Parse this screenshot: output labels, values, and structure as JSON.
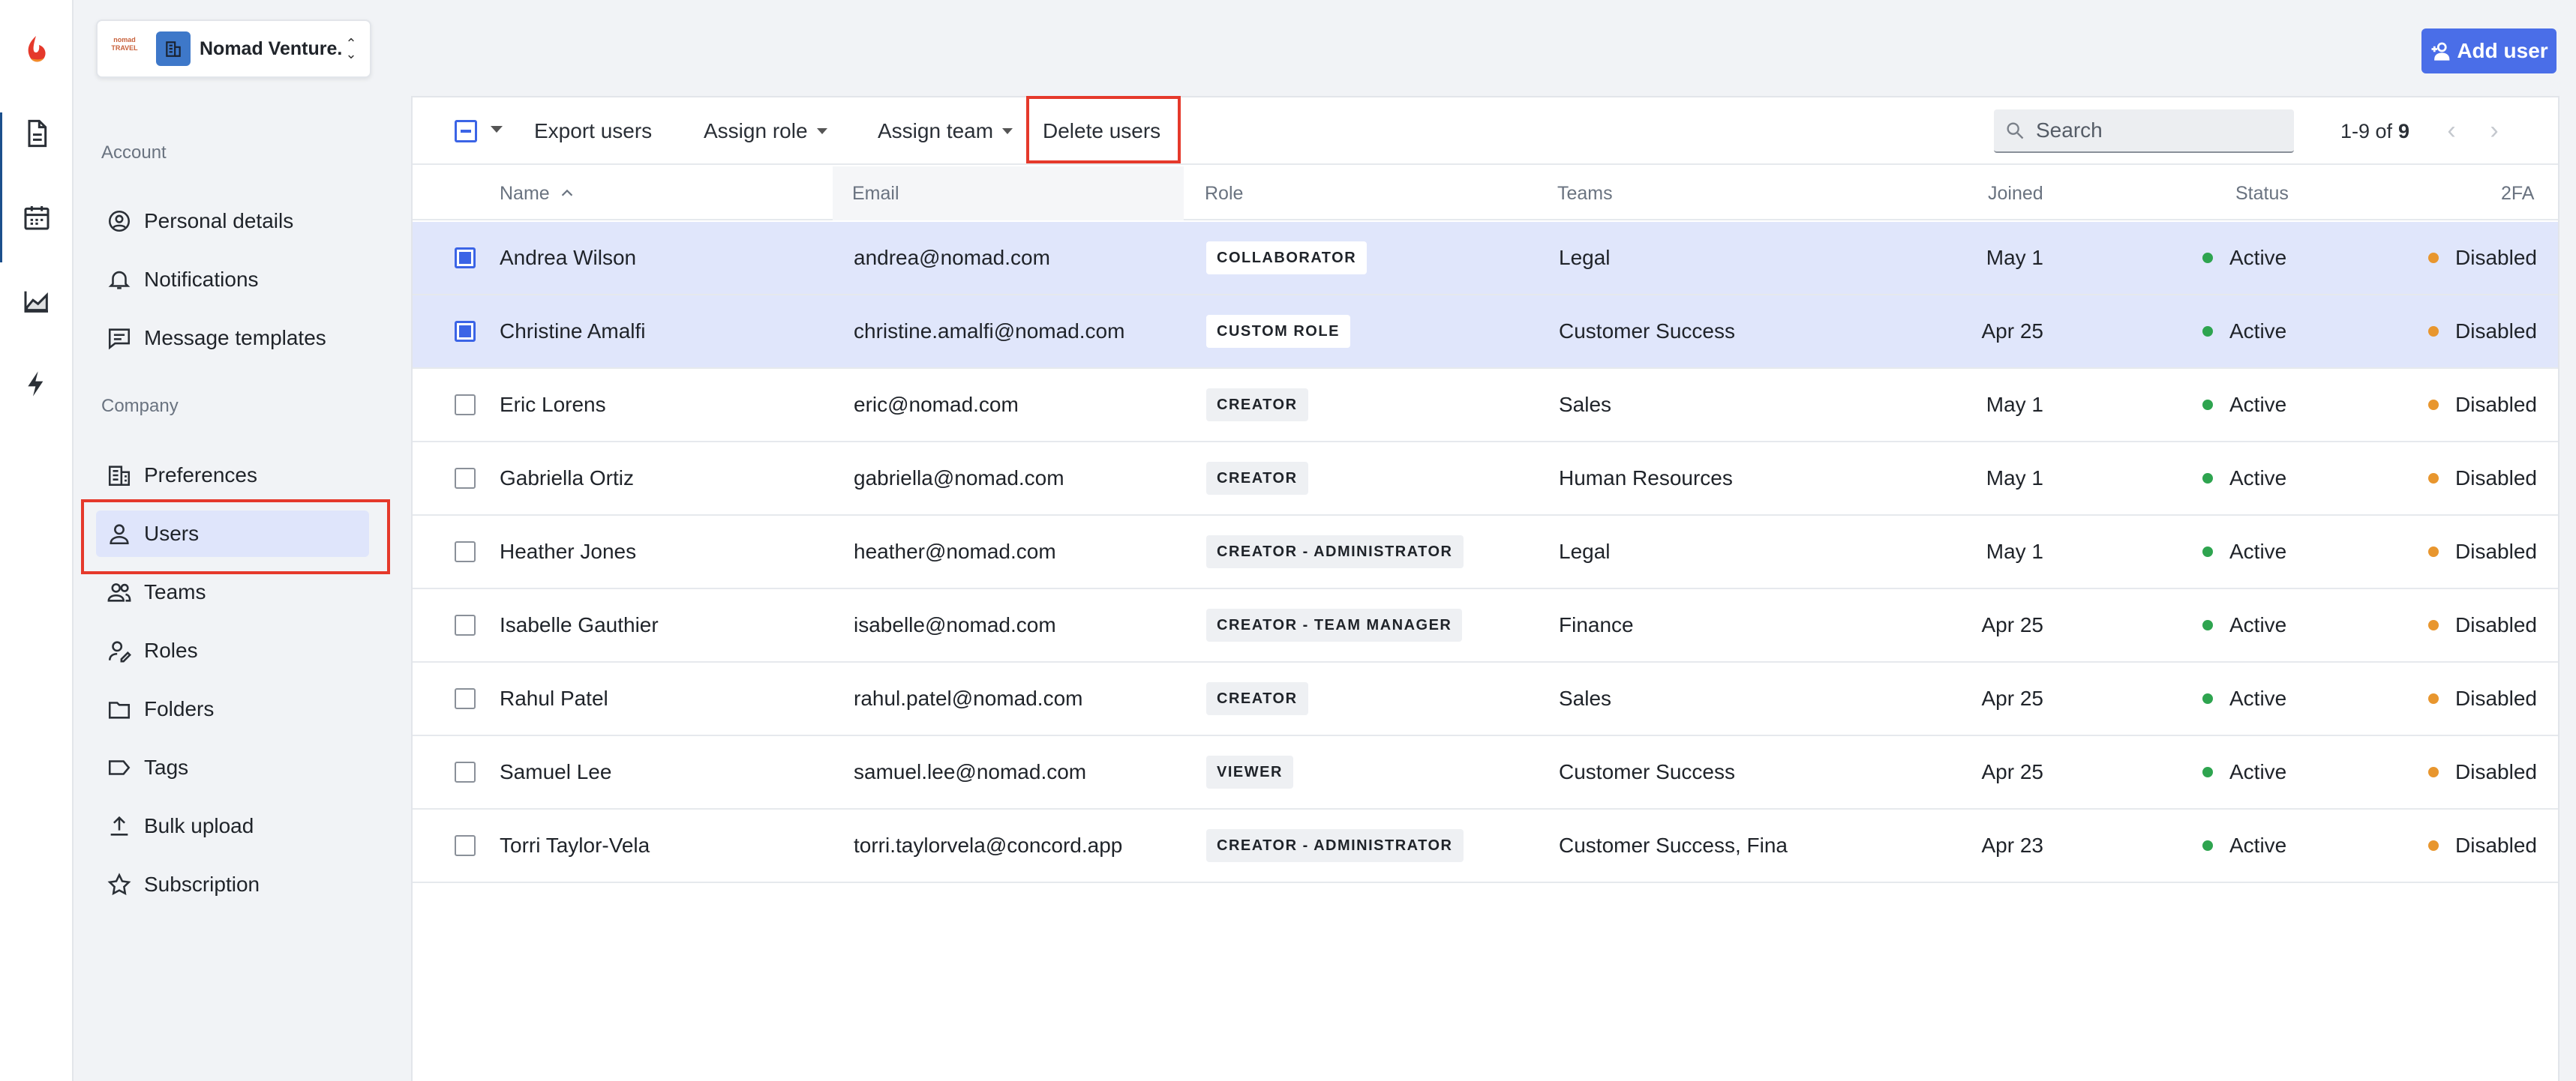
{
  "org": {
    "logo_text": "nomad TRAVEL",
    "name": "Nomad Venture..."
  },
  "sidebar": {
    "account_label": "Account",
    "company_label": "Company",
    "account_items": [
      {
        "label": "Personal details",
        "icon": "person-circle-icon"
      },
      {
        "label": "Notifications",
        "icon": "bell-icon"
      },
      {
        "label": "Message templates",
        "icon": "message-icon"
      }
    ],
    "company_items": [
      {
        "label": "Preferences",
        "icon": "building-settings-icon"
      },
      {
        "label": "Users",
        "icon": "person-icon",
        "active": true
      },
      {
        "label": "Teams",
        "icon": "people-icon"
      },
      {
        "label": "Roles",
        "icon": "person-edit-icon"
      },
      {
        "label": "Folders",
        "icon": "folder-icon"
      },
      {
        "label": "Tags",
        "icon": "tag-icon"
      },
      {
        "label": "Bulk upload",
        "icon": "upload-icon"
      },
      {
        "label": "Subscription",
        "icon": "star-icon"
      }
    ]
  },
  "header": {
    "add_user_label": "Add user"
  },
  "toolbar": {
    "export_label": "Export users",
    "assign_role_label": "Assign role",
    "assign_team_label": "Assign team",
    "delete_label": "Delete users",
    "search_placeholder": "Search",
    "pager_range": "1-9 of",
    "pager_total": "9"
  },
  "table": {
    "columns": [
      "Name",
      "Email",
      "Role",
      "Teams",
      "Joined",
      "Status",
      "2FA"
    ],
    "rows": [
      {
        "name": "Andrea Wilson",
        "email": "andrea@nomad.com",
        "role": "COLLABORATOR",
        "teams": "Legal",
        "joined": "May 1",
        "status": "Active",
        "twofa": "Disabled",
        "selected": true
      },
      {
        "name": "Christine Amalfi",
        "email": "christine.amalfi@nomad.com",
        "role": "CUSTOM ROLE",
        "teams": "Customer Success",
        "joined": "Apr 25",
        "status": "Active",
        "twofa": "Disabled",
        "selected": true
      },
      {
        "name": "Eric Lorens",
        "email": "eric@nomad.com",
        "role": "CREATOR",
        "teams": "Sales",
        "joined": "May 1",
        "status": "Active",
        "twofa": "Disabled",
        "selected": false
      },
      {
        "name": "Gabriella Ortiz",
        "email": "gabriella@nomad.com",
        "role": "CREATOR",
        "teams": "Human Resources",
        "joined": "May 1",
        "status": "Active",
        "twofa": "Disabled",
        "selected": false
      },
      {
        "name": "Heather Jones",
        "email": "heather@nomad.com",
        "role": "CREATOR - ADMINISTRATOR",
        "teams": "Legal",
        "joined": "May 1",
        "status": "Active",
        "twofa": "Disabled",
        "selected": false
      },
      {
        "name": "Isabelle Gauthier",
        "email": "isabelle@nomad.com",
        "role": "CREATOR - TEAM MANAGER",
        "teams": "Finance",
        "joined": "Apr 25",
        "status": "Active",
        "twofa": "Disabled",
        "selected": false
      },
      {
        "name": "Rahul Patel",
        "email": "rahul.patel@nomad.com",
        "role": "CREATOR",
        "teams": "Sales",
        "joined": "Apr 25",
        "status": "Active",
        "twofa": "Disabled",
        "selected": false
      },
      {
        "name": "Samuel Lee",
        "email": "samuel.lee@nomad.com",
        "role": "VIEWER",
        "teams": "Customer Success",
        "joined": "Apr 25",
        "status": "Active",
        "twofa": "Disabled",
        "selected": false
      },
      {
        "name": "Torri Taylor-Vela",
        "email": "torri.taylorvela@concord.app",
        "role": "CREATOR - ADMINISTRATOR",
        "teams": "Customer Success, Fina",
        "joined": "Apr 23",
        "status": "Active",
        "twofa": "Disabled",
        "selected": false
      }
    ]
  },
  "colors": {
    "accent": "#4a6ee8",
    "selected_row": "#e0e6fb",
    "highlight": "#e5392b",
    "status_active": "#2ea44f",
    "twofa_disabled": "#e8962e"
  }
}
